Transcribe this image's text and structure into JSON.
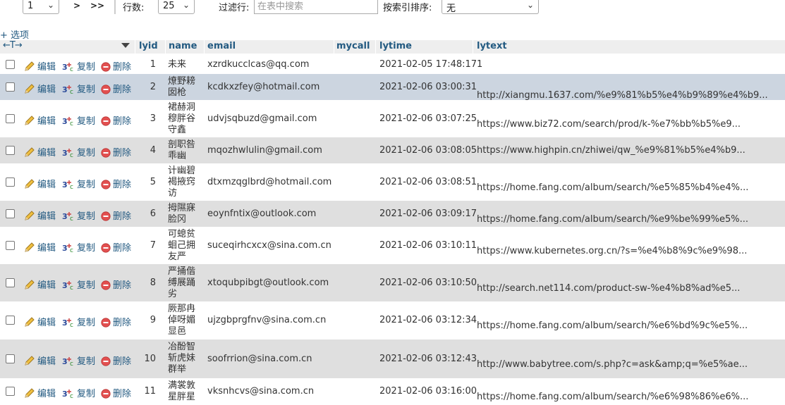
{
  "toolbar": {
    "page_select": "1",
    "next_label": ">",
    "last_label": ">>",
    "rows_label": "行数:",
    "rows_value": "25",
    "filter_label": "过滤行:",
    "filter_placeholder": "在表中搜索",
    "sort_label": "按索引排序:",
    "sort_value": "无"
  },
  "options_label": "选项",
  "options_plus": "+",
  "columns": [
    "lyid",
    "name",
    "email",
    "mycall",
    "lytime",
    "lytext"
  ],
  "actions": {
    "edit": "编辑",
    "copy": "复制",
    "delete": "删除"
  },
  "colors": {
    "link": "#235a81",
    "row_even": "#dfdfdf",
    "row_highlight": "#ccd5e0"
  },
  "rows": [
    {
      "lyid": "1",
      "name": "未来",
      "email": "xzrdkucclcas@qq.com",
      "mycall": "",
      "lytime": "2021-02-05 17:48:17",
      "lytext": "1"
    },
    {
      "lyid": "2",
      "name": "燎野耪囡枪",
      "email": "kcdkxzfey@hotmail.com",
      "mycall": "",
      "lytime": "2021-02-06 03:00:31",
      "lytext": "http://xiangmu.1637.com/%e9%81%b5%e4%b9%89%e4%b9..."
    },
    {
      "lyid": "3",
      "name": "裙赫洞穆胖谷守鑫",
      "email": "udvjsqbuzd@gmail.com",
      "mycall": "",
      "lytime": "2021-02-06 03:07:25",
      "lytext": "https://www.biz72.com/search/prod/k-%e7%bb%b5%e9..."
    },
    {
      "lyid": "4",
      "name": "剖职咎乖幽",
      "email": "mqozhwlulin@gmail.com",
      "mycall": "",
      "lytime": "2021-02-06 03:08:05",
      "lytext": "https://www.highpin.cn/zhiwei/qw_%e9%81%b5%e4%b9..."
    },
    {
      "lyid": "5",
      "name": "计幽碧褐掖窍访",
      "email": "dtxmzqglbrd@hotmail.com",
      "mycall": "",
      "lytime": "2021-02-06 03:08:51",
      "lytext": "https://home.fang.com/album/search/%e5%85%b4%e4%..."
    },
    {
      "lyid": "6",
      "name": "拇隰寐脸冈",
      "email": "eoynfntix@outlook.com",
      "mycall": "",
      "lytime": "2021-02-06 03:09:17",
      "lytext": "https://home.fang.com/album/search/%e9%be%99%e5%..."
    },
    {
      "lyid": "7",
      "name": "可螅贫蛔己拥友严",
      "email": "suceqirhcxcx@sina.com.cn",
      "mycall": "",
      "lytime": "2021-02-06 03:10:11",
      "lytext": "https://www.kubernetes.org.cn/?s=%e4%b8%9c%e9%98..."
    },
    {
      "lyid": "8",
      "name": "严捅偕缚展踊劣",
      "email": "xtoqubpibgt@outlook.com",
      "mycall": "",
      "lytime": "2021-02-06 03:10:50",
      "lytext": "http://search.net114.com/product-sw-%e4%b8%ad%e5..."
    },
    {
      "lyid": "9",
      "name": "厥那冉倬呀媚显邑",
      "email": "ujzgbprgfnv@sina.com.cn",
      "mycall": "",
      "lytime": "2021-02-06 03:12:34",
      "lytext": "https://home.fang.com/album/search/%e6%bd%9c%e5%..."
    },
    {
      "lyid": "10",
      "name": "冶酚智斩虎妹群举",
      "email": "soofrrion@sina.com.cn",
      "mycall": "",
      "lytime": "2021-02-06 03:12:43",
      "lytext": "http://www.babytree.com/s.php?c=ask&amp;q=%e5%ae..."
    },
    {
      "lyid": "11",
      "name": "满裳敦星胖星",
      "email": "vksnhcvs@sina.com.cn",
      "mycall": "",
      "lytime": "2021-02-06 03:16:00",
      "lytext": "https://home.fang.com/album/search/%e6%98%86%e6%..."
    }
  ]
}
